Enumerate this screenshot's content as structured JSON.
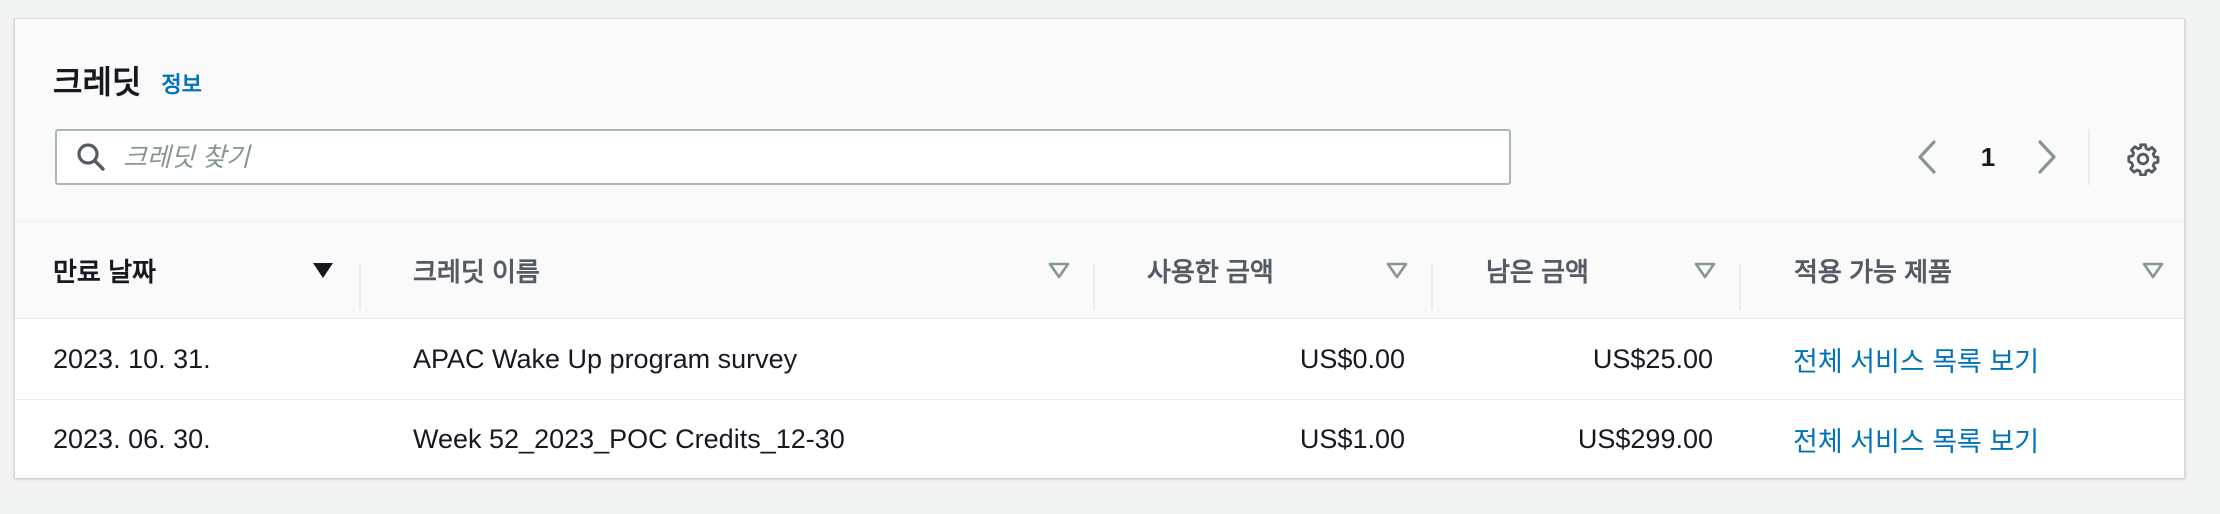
{
  "header": {
    "title": "크레딧",
    "info_link": "정보"
  },
  "search": {
    "placeholder": "크레딧 찾기",
    "value": ""
  },
  "pagination": {
    "current_page": "1"
  },
  "columns": {
    "expiration_date": "만료 날짜",
    "credit_name": "크레딧 이름",
    "amount_used": "사용한 금액",
    "amount_remaining": "남은 금액",
    "applicable_products": "적용 가능 제품"
  },
  "rows": [
    {
      "expiration_date": "2023. 10. 31.",
      "credit_name": "APAC Wake Up program survey",
      "amount_used": "US$0.00",
      "amount_remaining": "US$25.00",
      "applicable_products": "전체 서비스 목록 보기"
    },
    {
      "expiration_date": "2023. 06. 30.",
      "credit_name": "Week 52_2023_POC Credits_12-30",
      "amount_used": "US$1.00",
      "amount_remaining": "US$299.00",
      "applicable_products": "전체 서비스 목록 보기"
    }
  ],
  "colors": {
    "link": "#0073bb",
    "text": "#16191f",
    "muted_text": "#545b64",
    "sort_icon": "#879596",
    "panel_bg": "#fafafa",
    "page_bg": "#f2f3f3"
  },
  "icons": {
    "search": "search-icon",
    "prev": "chevron-left-icon",
    "next": "chevron-right-icon",
    "settings": "gear-icon",
    "sort_active": "caret-down-filled-icon",
    "sort_inactive": "caret-down-outline-icon"
  }
}
